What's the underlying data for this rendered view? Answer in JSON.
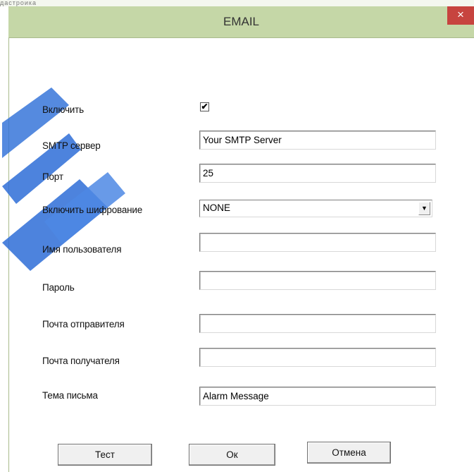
{
  "top_fragment": "дастроика",
  "dialog": {
    "title": "EMAIL",
    "close_symbol": "×"
  },
  "form": {
    "enable": {
      "label": "Включить",
      "checked": true,
      "check_glyph": "✔"
    },
    "smtp_server": {
      "label": "SMTP сервер",
      "value": "Your SMTP Server"
    },
    "port": {
      "label": "Порт",
      "value": "25"
    },
    "encryption": {
      "label": "Включить шифрование",
      "value": "NONE",
      "arrow": "▼"
    },
    "username": {
      "label": "Имя пользователя",
      "value": ""
    },
    "password": {
      "label": "Пароль",
      "value": ""
    },
    "sender": {
      "label": "Почта отправителя",
      "value": ""
    },
    "recipient": {
      "label": "Почта получателя",
      "value": ""
    },
    "subject": {
      "label": "Тема письма",
      "value": "Alarm Message"
    }
  },
  "buttons": {
    "test": "Тест",
    "ok": "Ок",
    "cancel": "Отмена"
  },
  "colors": {
    "titlebar": "#c5d7a7",
    "close_button": "#c7443f",
    "watermark": "#2f6fd8"
  }
}
